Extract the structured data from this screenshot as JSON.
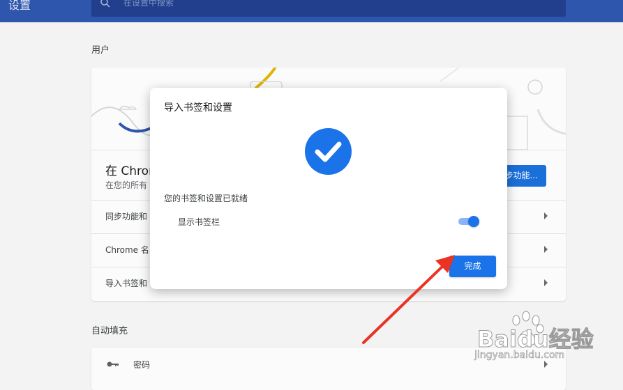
{
  "header": {
    "title": "设置",
    "search_placeholder": "在设置中搜索"
  },
  "people_section": {
    "title": "用户",
    "hero_text": "在 Chrom",
    "hero_subtext": "在您的所有",
    "sync_button": "步功能...",
    "rows": [
      {
        "label": "同步功能和"
      },
      {
        "label": "Chrome 名"
      },
      {
        "label": "导入书签和"
      }
    ]
  },
  "autofill_section": {
    "title": "自动填充",
    "rows": [
      {
        "label": "密码",
        "icon": "key-icon"
      }
    ]
  },
  "dialog": {
    "title": "导入书签和设置",
    "icon": "check-circle-icon",
    "status": "您的书签和设置已就绪",
    "show_bookmarks_bar": "显示书签栏",
    "toggle_on": true,
    "done_button": "完成"
  },
  "watermark": {
    "brand": "Baidu经验",
    "url": "jingyan.baidu.com"
  },
  "colors": {
    "header": "#2f56ad",
    "search": "#223f8d",
    "accent": "#1a73e8",
    "arrow": "#ea3323"
  }
}
